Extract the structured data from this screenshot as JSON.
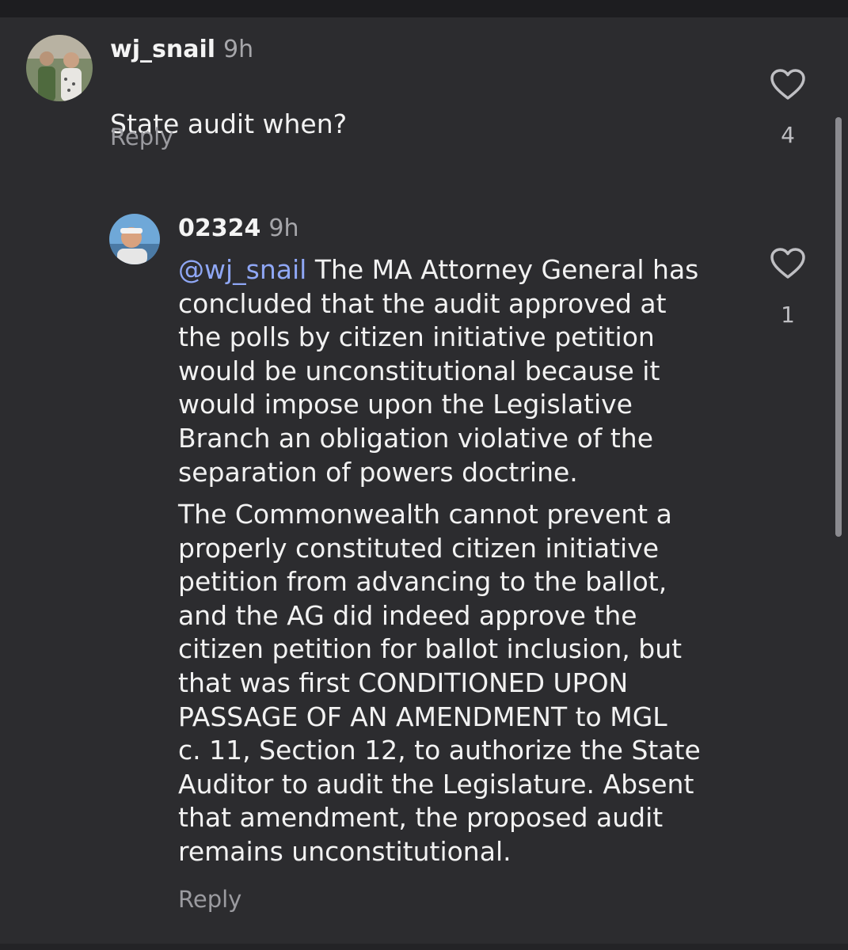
{
  "comments": [
    {
      "username": "wj_snail",
      "time": "9h",
      "text": "State audit when?",
      "reply_label": "Reply",
      "like_count": "4",
      "avatar_icon": "user-avatar"
    },
    {
      "username": "02324",
      "time": "9h",
      "mention": "@wj_snail",
      "paragraph_1": " The MA Attorney General has\nconcluded that the audit approved at\nthe polls by citizen initiative petition\nwould be unconstitutional because it\nwould impose upon the Legislative\nBranch an obligation violative of the\nseparation of powers doctrine.",
      "paragraph_2": "The Commonwealth cannot prevent a\nproperly constituted citizen initiative\npetition from advancing to the ballot,\nand the AG did indeed approve the\ncitizen petition for ballot inclusion, but\nthat was first CONDITIONED UPON\nPASSAGE OF AN AMENDMENT to MGL\nc. 11, Section 12, to authorize the State\nAuditor to audit the Legislature.  Absent\nthat amendment, the proposed audit\nremains unconstitutional.",
      "reply_label": "Reply",
      "like_count": "1",
      "avatar_icon": "user-avatar"
    }
  ],
  "colors": {
    "background": "#2c2c2f",
    "mention": "#8fa7f5",
    "muted": "#9b9ba0"
  },
  "icons": {
    "like": "heart-outline-icon"
  }
}
